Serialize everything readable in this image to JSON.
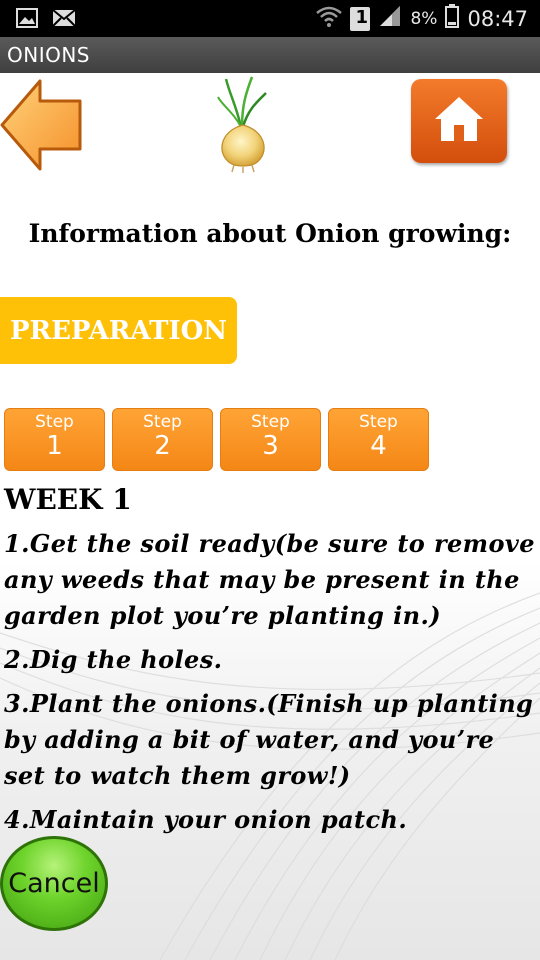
{
  "status_bar": {
    "battery_percent": "8%",
    "time": "08:47",
    "sim_badge": "1",
    "icons": [
      "image-icon",
      "mail-icon",
      "wifi-icon",
      "sim-icon",
      "signal-icon",
      "battery-icon"
    ]
  },
  "app": {
    "title": "ONIONS"
  },
  "nav": {
    "back_icon": "back-arrow-icon",
    "home_icon": "home-icon",
    "logo_icon": "onion-icon"
  },
  "heading": "Information about Onion growing:",
  "preparation_label": "PREPARATION",
  "steps": [
    {
      "word": "Step",
      "num": "1"
    },
    {
      "word": "Step",
      "num": "2"
    },
    {
      "word": "Step",
      "num": "3"
    },
    {
      "word": "Step",
      "num": "4"
    }
  ],
  "week_title": "WEEK 1",
  "instructions": [
    "1.Get the soil ready(be sure to remove any weeds that may be present in the garden plot you’re planting in.)",
    "2.Dig the holes.",
    "3.Plant the onions.(Finish up planting by adding a bit of water, and you’re set to watch them grow!)",
    "4.Maintain your onion patch."
  ],
  "cancel_label": "Cancel",
  "colors": {
    "status_bar": "#000000",
    "title_bar": "#4a4a4a",
    "preparation": "#ffc107",
    "step": "#f48716",
    "home": "#e0601a",
    "cancel": "#6fd42c"
  }
}
